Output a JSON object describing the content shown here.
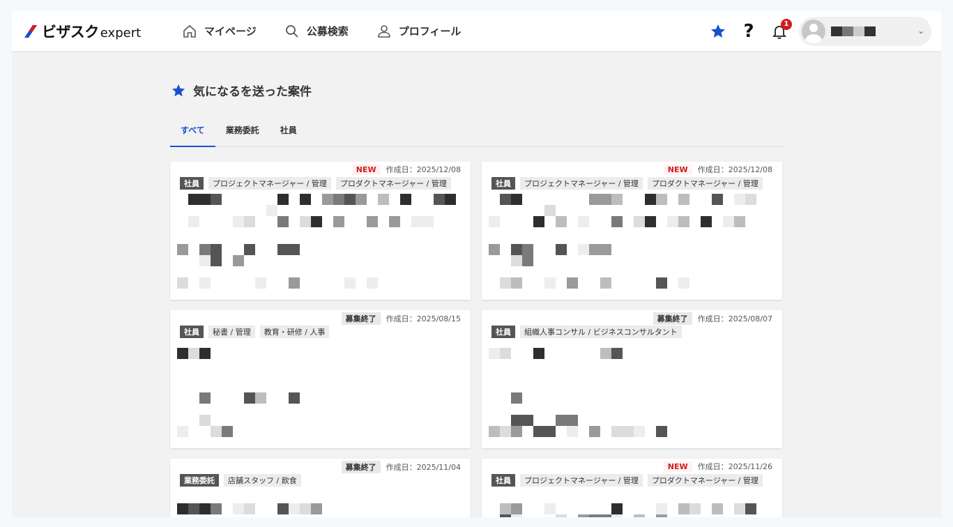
{
  "app": {
    "logo_main": "ビザスク",
    "logo_sub": "expert",
    "colors": {
      "brand_blue": "#1a4fcf",
      "brand_red": "#d21c1c",
      "accent_purple": "#6e4bd8"
    }
  },
  "nav": [
    {
      "label": "マイページ",
      "icon": "home-icon"
    },
    {
      "label": "公募検索",
      "icon": "search-icon"
    },
    {
      "label": "プロフィール",
      "icon": "person-icon"
    }
  ],
  "header_right": {
    "favorites_icon": "star-icon",
    "help_icon": "question-icon",
    "help_glyph": "?",
    "notifications_icon": "bell-icon",
    "notification_count": "1",
    "user_menu_icon": "chevron-down-icon",
    "user_menu_glyph": "⌄"
  },
  "page": {
    "title": "気になるを送った案件",
    "title_icon": "star-icon"
  },
  "tabs": [
    {
      "label": "すべて",
      "active": true
    },
    {
      "label": "業務委託",
      "active": false
    },
    {
      "label": "社員",
      "active": false
    }
  ],
  "cards": [
    {
      "status": "NEW",
      "status_type": "new",
      "created": "作成日：2025/12/08",
      "tags": [
        "社員",
        "プロジェクトマネージャー / 管理",
        "プロダクトマネージャー / 管理"
      ]
    },
    {
      "status": "NEW",
      "status_type": "new",
      "created": "作成日：2025/12/08",
      "tags": [
        "社員",
        "プロジェクトマネージャー / 管理",
        "プロダクトマネージャー / 管理"
      ]
    },
    {
      "status": "募集終了",
      "status_type": "closed",
      "created": "作成日：2025/08/15",
      "tags": [
        "社員",
        "秘書 / 管理",
        "教育・研修 / 人事"
      ]
    },
    {
      "status": "募集終了",
      "status_type": "closed",
      "created": "作成日：2025/08/07",
      "tags": [
        "社員",
        "組織人事コンサル / ビジネスコンサルタント"
      ]
    },
    {
      "status": "募集終了",
      "status_type": "closed",
      "created": "作成日：2025/11/04",
      "tags": [
        "業務委託",
        "店舗スタッフ / 飲食"
      ]
    },
    {
      "status": "NEW",
      "status_type": "new",
      "created": "作成日：2025/11/26",
      "tags": [
        "社員",
        "プロジェクトマネージャー / 管理",
        "プロダクトマネージャー / 管理"
      ]
    }
  ]
}
